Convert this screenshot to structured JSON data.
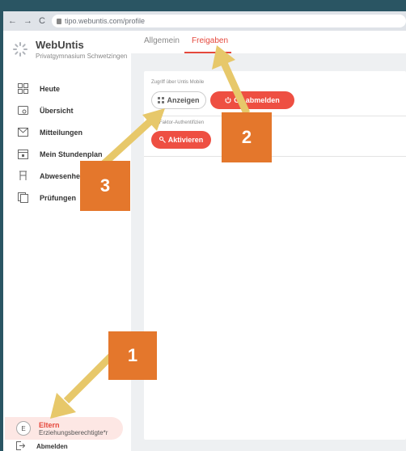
{
  "browser": {
    "back": "←",
    "forward": "→",
    "reload": "C",
    "url": "tipo.webuntis.com/profile"
  },
  "brand": {
    "name": "WebUntis",
    "school": "Privatgymnasium Schwetzingen"
  },
  "sidebar": {
    "items": [
      {
        "label": "Heute",
        "icon": "dashboard-icon"
      },
      {
        "label": "Übersicht",
        "icon": "overview-icon"
      },
      {
        "label": "Mitteilungen",
        "icon": "mail-icon"
      },
      {
        "label": "Mein Stundenplan",
        "icon": "calendar-icon"
      },
      {
        "label": "Abwesenhei",
        "icon": "absence-icon"
      },
      {
        "label": "Prüfungen",
        "icon": "exam-icon"
      }
    ],
    "user": {
      "initial": "E",
      "name": "Eltern",
      "role": "Erziehungsberechtigte*r"
    },
    "logout_label": "Abmelden"
  },
  "tabs": [
    {
      "label": "Allgemein",
      "active": false
    },
    {
      "label": "Freigaben",
      "active": true
    }
  ],
  "sections": {
    "mobile_label": "Zugriff über Untis Mobile",
    "show_button": "Anzeigen",
    "logout_devices_button": "Ge abmelden",
    "twofactor_label": "wei-Faktor-Authentifizien",
    "activate_button": "Aktivieren"
  },
  "annotations": {
    "badge1": "1",
    "badge2": "2",
    "badge3": "3"
  },
  "colors": {
    "accent": "#e5483c",
    "badge": "#e4772c",
    "arrow": "#e7c86a"
  }
}
